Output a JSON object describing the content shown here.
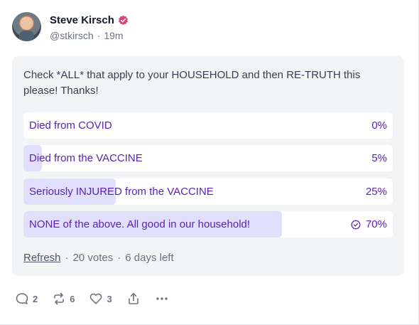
{
  "user": {
    "name": "Steve Kirsch",
    "handle": "@stkirsch",
    "time": "19m"
  },
  "post": {
    "text": "Check *ALL* that apply to your HOUSEHOLD and then RE-TRUTH this please! Thanks!"
  },
  "poll": {
    "options": [
      {
        "label": "Died from COVID",
        "percent": "0%",
        "fraction": 0.0
      },
      {
        "label": "Died from the VACCINE",
        "percent": "5%",
        "fraction": 0.05
      },
      {
        "label": "Seriously INJURED from the VACCINE",
        "percent": "25%",
        "fraction": 0.25
      },
      {
        "label": "NONE of the above. All good in our household!",
        "percent": "70%",
        "fraction": 0.7,
        "selected": true
      }
    ],
    "refresh_label": "Refresh",
    "votes": "20 votes",
    "time_left": "6 days left"
  },
  "actions": {
    "replies": "2",
    "retruths": "6",
    "likes": "3"
  },
  "colors": {
    "option_text": "#5b21b6",
    "option_fill": "#e0e0fc",
    "verified_badge": "#e53e7a"
  }
}
